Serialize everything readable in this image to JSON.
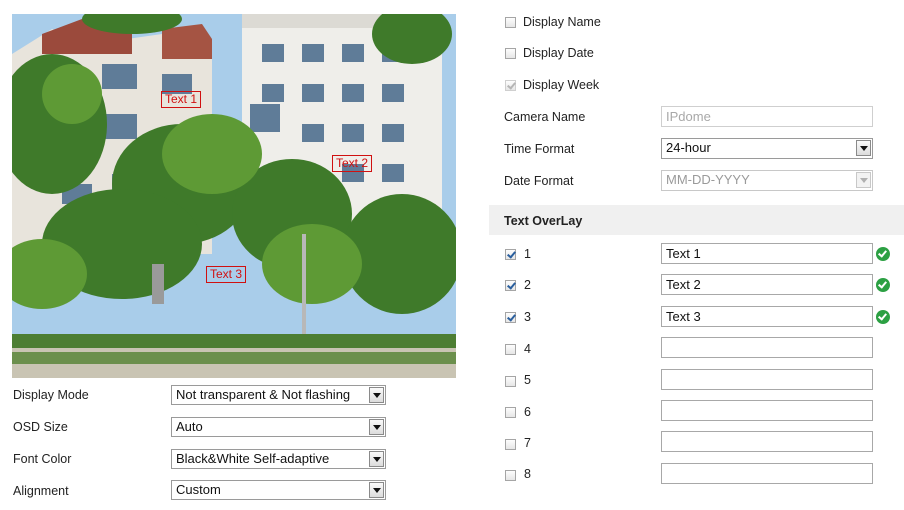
{
  "preview": {
    "overlays": [
      {
        "label": "Text 1"
      },
      {
        "label": "Text 2"
      },
      {
        "label": "Text 3"
      }
    ]
  },
  "display": {
    "display_mode_label": "Display Mode",
    "display_mode_value": "Not transparent & Not flashing",
    "osd_size_label": "OSD Size",
    "osd_size_value": "Auto",
    "font_color_label": "Font Color",
    "font_color_value": "Black&White Self-adaptive",
    "alignment_label": "Alignment",
    "alignment_value": "Custom"
  },
  "settings": {
    "display_name_label": "Display Name",
    "display_name_checked": false,
    "display_date_label": "Display Date",
    "display_date_checked": false,
    "display_week_label": "Display Week",
    "display_week_checked": true,
    "camera_name_label": "Camera Name",
    "camera_name_value": "IPdome",
    "time_format_label": "Time Format",
    "time_format_value": "24-hour",
    "date_format_label": "Date Format",
    "date_format_value": "MM-DD-YYYY"
  },
  "text_overlay": {
    "title": "Text OverLay",
    "rows": [
      {
        "num": "1",
        "checked": true,
        "value": "Text 1"
      },
      {
        "num": "2",
        "checked": true,
        "value": "Text 2"
      },
      {
        "num": "3",
        "checked": true,
        "value": "Text 3"
      },
      {
        "num": "4",
        "checked": false,
        "value": ""
      },
      {
        "num": "5",
        "checked": false,
        "value": ""
      },
      {
        "num": "6",
        "checked": false,
        "value": ""
      },
      {
        "num": "7",
        "checked": false,
        "value": ""
      },
      {
        "num": "8",
        "checked": false,
        "value": ""
      }
    ]
  },
  "colors": {
    "overlay_border": "#d01010",
    "valid_check": "#2ca043",
    "section_header_bg": "#f0f0f0"
  }
}
